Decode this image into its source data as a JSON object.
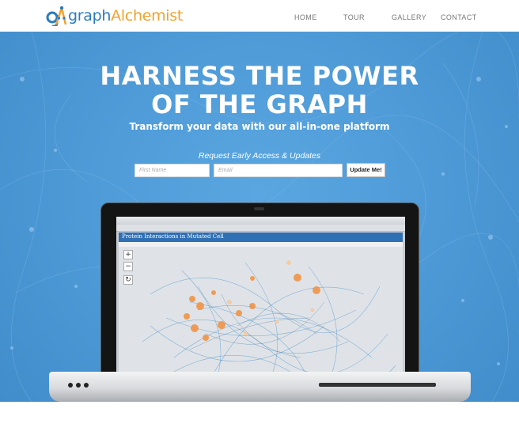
{
  "brand": {
    "logo_icon": "graph-nodes-icon",
    "name_part1": "graph",
    "name_part2": "Alchemist",
    "colors": {
      "blue": "#2a7bc0",
      "orange": "#f0a22e"
    }
  },
  "nav": {
    "items": [
      "HOME",
      "TOUR",
      "GALLERY",
      "CONTACT"
    ]
  },
  "hero": {
    "headline_line1": "HARNESS THE POWER",
    "headline_line2": "OF THE GRAPH",
    "subheadline": "Transform your data with our all-in-one platform",
    "background_color": "#4f9bd8"
  },
  "signup": {
    "label": "Request Early Access & Updates",
    "first_name_placeholder": "First Name",
    "email_placeholder": "Email",
    "submit_label": "Update Me!"
  },
  "screenshot": {
    "app_title": "Protein Interactions in Mutated Cell",
    "zoom_in": "+",
    "zoom_out": "−",
    "reset": "↻"
  }
}
